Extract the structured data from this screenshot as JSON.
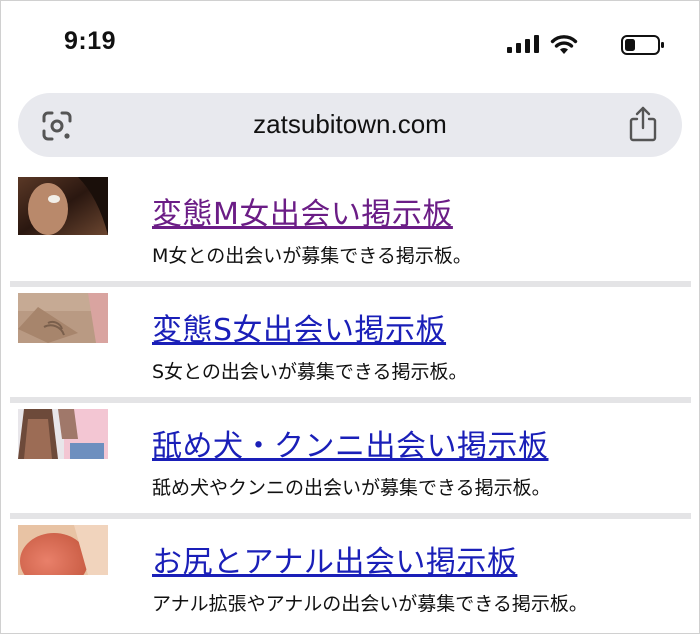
{
  "status": {
    "time": "9:19"
  },
  "address_bar": {
    "url": "zatsubitown.com"
  },
  "colors": {
    "visited_link": "#6b1d86",
    "link": "#1a1fb8"
  },
  "entries": [
    {
      "title": "変態M女出会い掲示板",
      "description": "M女との出会いが募集できる掲示板。",
      "visited": true
    },
    {
      "title": "変態S女出会い掲示板",
      "description": "S女との出会いが募集できる掲示板。",
      "visited": false
    },
    {
      "title": "舐め犬・クンニ出会い掲示板",
      "description": "舐め犬やクンニの出会いが募集できる掲示板。",
      "visited": false
    },
    {
      "title": "お尻とアナル出会い掲示板",
      "description": "アナル拡張やアナルの出会いが募集できる掲示板。",
      "visited": false
    }
  ]
}
